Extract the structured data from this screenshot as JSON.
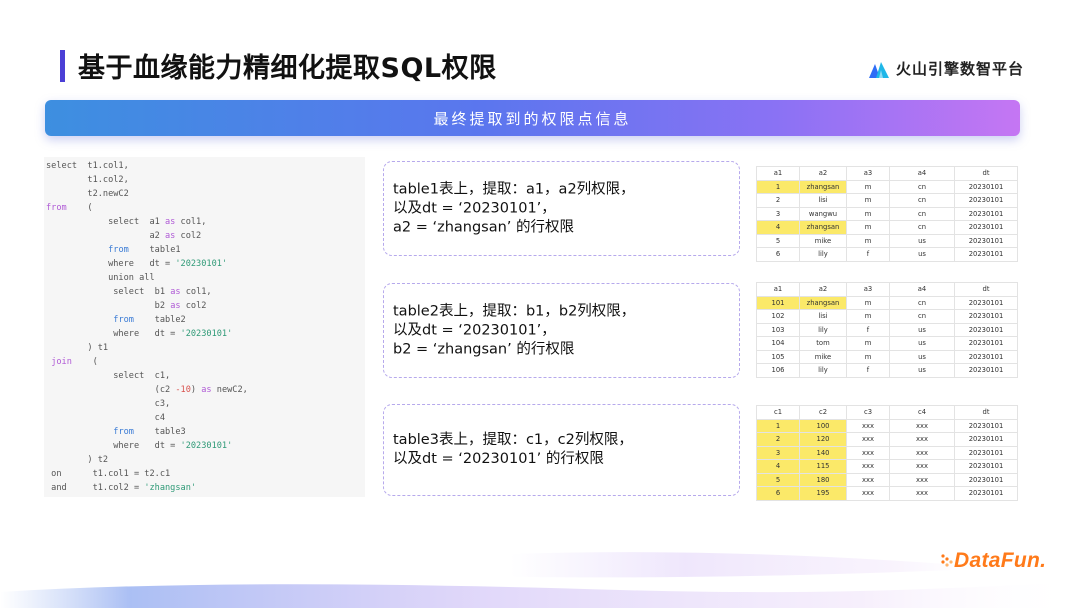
{
  "header": {
    "title": "基于血缘能力精细化提取SQL权限",
    "brand": "火山引擎数智平台",
    "logo_color": "#2f6df6",
    "accent_bar_color": "#4b3fd6"
  },
  "banner": {
    "text": "最终提取到的权限点信息"
  },
  "sql_lines": [
    [
      {
        "t": "select  t1.col1,"
      }
    ],
    [
      {
        "t": "        t1.col2,"
      }
    ],
    [
      {
        "t": "        t2.newC2"
      }
    ],
    [
      {
        "t": "from",
        "c": "kw"
      },
      {
        "t": "    ("
      }
    ],
    [
      {
        "t": "            select  a1 "
      },
      {
        "t": "as",
        "c": "kw"
      },
      {
        "t": " col1,"
      }
    ],
    [
      {
        "t": "                    a2 "
      },
      {
        "t": "as",
        "c": "kw"
      },
      {
        "t": " col2"
      }
    ],
    [
      {
        "t": "            "
      },
      {
        "t": "from",
        "c": "blue"
      },
      {
        "t": "    table1"
      }
    ],
    [
      {
        "t": "            where   dt = "
      },
      {
        "t": "'20230101'",
        "c": "str"
      }
    ],
    [
      {
        "t": "            union all"
      }
    ],
    [
      {
        "t": "             select  b1 "
      },
      {
        "t": "as",
        "c": "kw"
      },
      {
        "t": " col1,"
      }
    ],
    [
      {
        "t": "                     b2 "
      },
      {
        "t": "as",
        "c": "kw"
      },
      {
        "t": " col2"
      }
    ],
    [
      {
        "t": "             "
      },
      {
        "t": "from",
        "c": "blue"
      },
      {
        "t": "    table2"
      }
    ],
    [
      {
        "t": "             where   dt = "
      },
      {
        "t": "'20230101'",
        "c": "str"
      }
    ],
    [
      {
        "t": "        ) t1"
      }
    ],
    [
      {
        "t": " "
      },
      {
        "t": "join",
        "c": "kw"
      },
      {
        "t": "    ("
      }
    ],
    [
      {
        "t": "             select  c1,"
      }
    ],
    [
      {
        "t": "                     (c2 "
      },
      {
        "t": "-10",
        "c": "num"
      },
      {
        "t": ") "
      },
      {
        "t": "as",
        "c": "kw"
      },
      {
        "t": " newC2,"
      }
    ],
    [
      {
        "t": "                     c3,"
      }
    ],
    [
      {
        "t": "                     c4"
      }
    ],
    [
      {
        "t": "             "
      },
      {
        "t": "from",
        "c": "blue"
      },
      {
        "t": "    table3"
      }
    ],
    [
      {
        "t": "             where   dt = "
      },
      {
        "t": "'20230101'",
        "c": "str"
      }
    ],
    [
      {
        "t": "        ) t2"
      }
    ],
    [
      {
        "t": " on      t1.col1 = t2.c1"
      }
    ],
    [
      {
        "t": " and     t1.col2 = "
      },
      {
        "t": "'zhangsan'",
        "c": "str"
      }
    ]
  ],
  "descriptions": [
    {
      "lines": [
        "table1表上，提取：a1，a2列权限，",
        "以及dt = ‘20230101’，",
        "a2 = ‘zhangsan’ 的行权限"
      ]
    },
    {
      "lines": [
        "table2表上，提取：b1，b2列权限，",
        "以及dt = ‘20230101’，",
        "b2 = ‘zhangsan’ 的行权限"
      ]
    },
    {
      "lines": [
        "table3表上，提取：c1，c2列权限，",
        "以及dt = ‘20230101’ 的行权限"
      ]
    }
  ],
  "tables": [
    {
      "columns": [
        "a1",
        "a2",
        "a3",
        "a4",
        "dt"
      ],
      "rows": [
        [
          "1",
          "zhangsan",
          "m",
          "cn",
          "20230101"
        ],
        [
          "2",
          "lisi",
          "m",
          "cn",
          "20230101"
        ],
        [
          "3",
          "wangwu",
          "m",
          "cn",
          "20230101"
        ],
        [
          "4",
          "zhangsan",
          "m",
          "cn",
          "20230101"
        ],
        [
          "5",
          "mike",
          "m",
          "us",
          "20230101"
        ],
        [
          "6",
          "lily",
          "f",
          "us",
          "20230101"
        ]
      ],
      "highlight_rows": [
        0,
        3
      ],
      "highlight_cols": [
        0,
        1
      ]
    },
    {
      "columns": [
        "a1",
        "a2",
        "a3",
        "a4",
        "dt"
      ],
      "rows": [
        [
          "101",
          "zhangsan",
          "m",
          "cn",
          "20230101"
        ],
        [
          "102",
          "lisi",
          "m",
          "cn",
          "20230101"
        ],
        [
          "103",
          "lily",
          "f",
          "us",
          "20230101"
        ],
        [
          "104",
          "tom",
          "m",
          "us",
          "20230101"
        ],
        [
          "105",
          "mike",
          "m",
          "us",
          "20230101"
        ],
        [
          "106",
          "lily",
          "f",
          "us",
          "20230101"
        ]
      ],
      "highlight_rows": [
        0
      ],
      "highlight_cols": [
        0,
        1
      ]
    },
    {
      "columns": [
        "c1",
        "c2",
        "c3",
        "c4",
        "dt"
      ],
      "rows": [
        [
          "1",
          "100",
          "xxx",
          "xxx",
          "20230101"
        ],
        [
          "2",
          "120",
          "xxx",
          "xxx",
          "20230101"
        ],
        [
          "3",
          "140",
          "xxx",
          "xxx",
          "20230101"
        ],
        [
          "4",
          "115",
          "xxx",
          "xxx",
          "20230101"
        ],
        [
          "5",
          "180",
          "xxx",
          "xxx",
          "20230101"
        ],
        [
          "6",
          "195",
          "xxx",
          "xxx",
          "20230101"
        ]
      ],
      "highlight_rows": [
        0,
        1,
        2,
        3,
        4,
        5
      ],
      "highlight_cols": [
        0,
        1
      ]
    }
  ],
  "footer": {
    "logo_text": "DataFun.",
    "logo_color": "#ff7a1a"
  }
}
